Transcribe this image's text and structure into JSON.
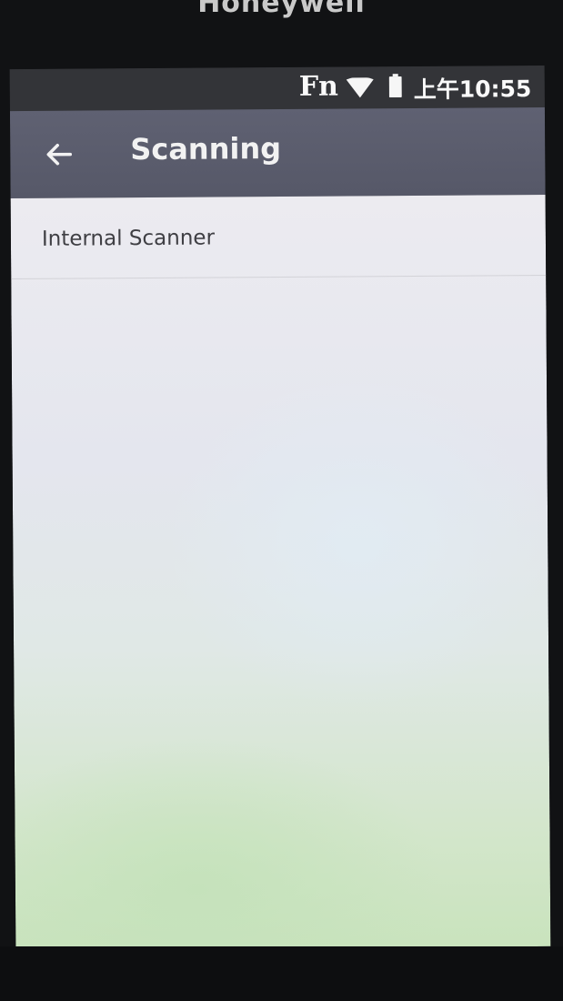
{
  "device": {
    "brand": "Honeywell"
  },
  "status_bar": {
    "fn_label": "Fn",
    "wifi_icon": "wifi-icon",
    "battery_icon": "battery-icon",
    "time": "上午10:55"
  },
  "app_bar": {
    "back_icon": "back-arrow-icon",
    "title": "Scanning"
  },
  "list": {
    "items": [
      {
        "label": "Internal Scanner"
      }
    ]
  },
  "colors": {
    "app_bar": "#5c5e6e",
    "status_bar": "#333438",
    "content_background": "#e8e9ef",
    "text_primary": "#3f3f44"
  }
}
